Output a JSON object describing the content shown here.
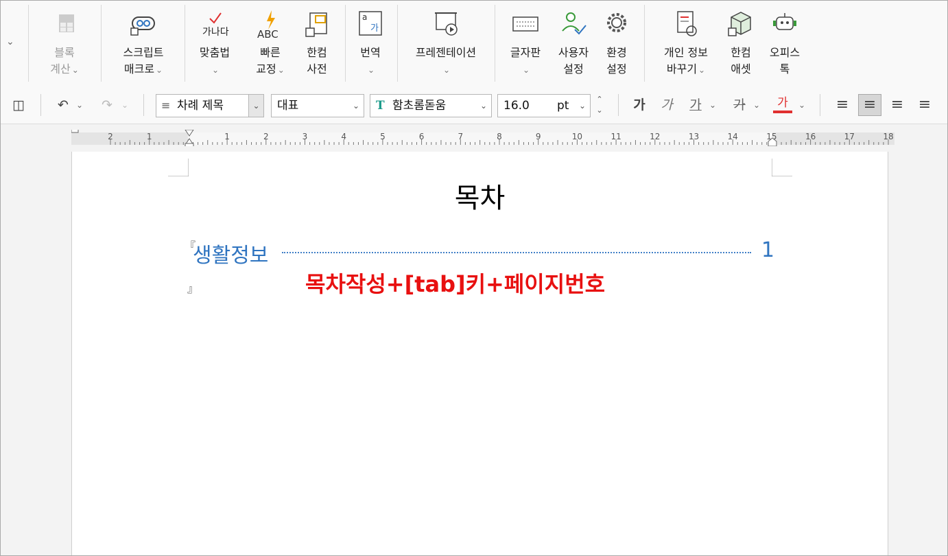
{
  "ribbon": {
    "block_calc": {
      "line1": "블록",
      "line2": "계산"
    },
    "script_macro": {
      "line1": "스크립트",
      "line2": "매크로"
    },
    "spellcheck": {
      "label": "맞춤법",
      "icon_text": "가나다"
    },
    "quick_correct": {
      "line1": "빠른",
      "line2": "교정",
      "icon_text": "ABC"
    },
    "hancom_dict": {
      "line1": "한컴",
      "line2": "사전"
    },
    "translate": {
      "label": "번역",
      "icon_text": "가"
    },
    "presentation": {
      "label": "프레젠테이션"
    },
    "char_map": {
      "label": "글자판"
    },
    "user_settings": {
      "line1": "사용자",
      "line2": "설정"
    },
    "env_settings": {
      "line1": "환경",
      "line2": "설정"
    },
    "privacy": {
      "line1": "개인 정보",
      "line2": "바꾸기"
    },
    "hancom_asset": {
      "line1": "한컴",
      "line2": "애셋"
    },
    "office_talk": {
      "line1": "오피스",
      "line2": "톡"
    }
  },
  "toolbar": {
    "style": "차례 제목",
    "font_lang": "대표",
    "font": "함초롬돋움",
    "font_size": "16.0",
    "size_unit": "pt",
    "bold_glyph": "가",
    "italic_glyph": "가",
    "underline_glyph": "가",
    "strike_glyph": "가",
    "color_glyph": "가"
  },
  "ruler": {
    "labels": [
      "2",
      "1",
      "",
      "1",
      "2",
      "3",
      "4",
      "5",
      "6",
      "7",
      "8",
      "9",
      "10",
      "11",
      "12",
      "13",
      "14",
      "15",
      "16",
      "17",
      "18"
    ]
  },
  "document": {
    "title": "목차",
    "toc_entry": "생활정보",
    "toc_page": "1",
    "open_mark": "『",
    "close_mark": "』",
    "annotation": "목차작성+[tab]키+페이지번호"
  },
  "colors": {
    "accent": "#2f74c0",
    "annotation": "#e81010"
  }
}
